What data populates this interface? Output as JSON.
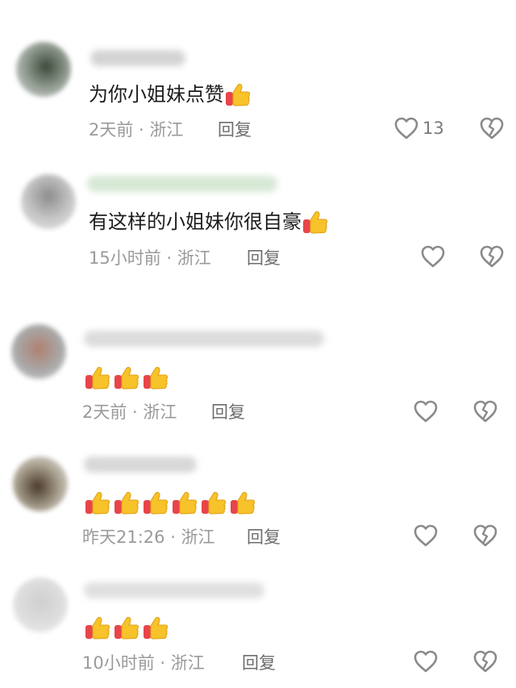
{
  "colors": {
    "icon": "#8a8a8a",
    "meta_text": "#9a9a9a",
    "body_text": "#1c1c1c"
  },
  "comments": [
    {
      "text": "为你小姐妹点赞",
      "thumbs": 1,
      "meta": "2天前 · 浙江",
      "reply": "回复",
      "like_count": "13"
    },
    {
      "text": "有这样的小姐妹你很自豪",
      "thumbs": 1,
      "meta": "15小时前 · 浙江",
      "reply": "回复",
      "like_count": ""
    },
    {
      "text": "",
      "thumbs": 3,
      "meta": "2天前 · 浙江",
      "reply": "回复",
      "like_count": ""
    },
    {
      "text": "",
      "thumbs": 6,
      "meta": "昨天21:26 · 浙江",
      "reply": "回复",
      "like_count": ""
    },
    {
      "text": "",
      "thumbs": 3,
      "meta": "10小时前 · 浙江",
      "reply": "回复",
      "like_count": ""
    }
  ],
  "icons": {
    "like": "heart-outline-icon",
    "dislike": "broken-heart-icon",
    "emoji": "thumbs-up-emoji"
  }
}
